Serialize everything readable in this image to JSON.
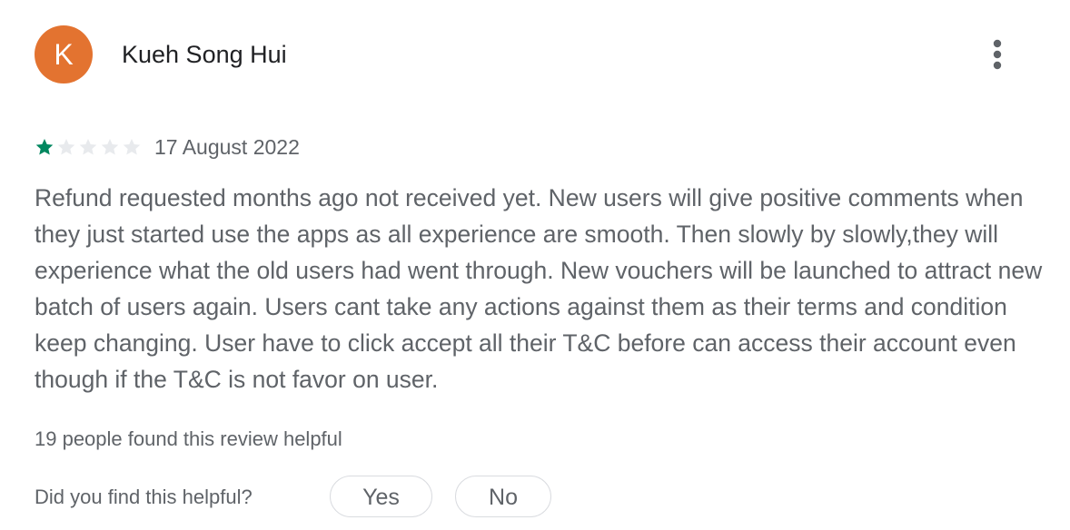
{
  "review": {
    "reviewer": {
      "initial": "K",
      "name": "Kueh Song Hui",
      "avatar_color": "#e37330"
    },
    "menu_icon": "more-vert-icon",
    "rating": {
      "value": 1,
      "max": 5,
      "filled_color": "#01875f",
      "empty_color": "#e8eaed"
    },
    "date": "17 August 2022",
    "text": "Refund requested months ago not received yet. New users will give positive comments when they just started use the apps as all experience are smooth. Then slowly by slowly,they will experience what the old users had went through. New vouchers will be launched to attract new batch of users again. Users cant take any actions against them as their terms and condition keep changing. User have to click accept all their T&C before can access their account even though if the T&C is not favor on user.",
    "helpful_count_text": "19 people found this review helpful",
    "helpful_prompt": "Did you find this helpful?",
    "yes_label": "Yes",
    "no_label": "No"
  }
}
